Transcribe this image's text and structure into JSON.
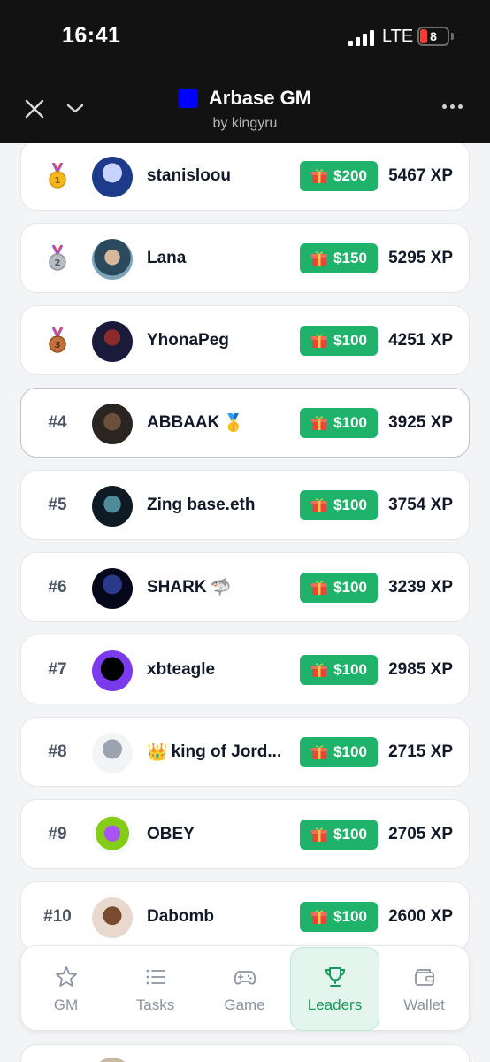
{
  "status_bar": {
    "time": "16:41",
    "network": "LTE",
    "battery": "8"
  },
  "header": {
    "title": "Arbase GM",
    "subtitle": "by kingyru"
  },
  "leaderboard": [
    {
      "rank": "",
      "medal": "gold",
      "name": "stanisloou",
      "prize": "$200",
      "xp": "5467 XP"
    },
    {
      "rank": "",
      "medal": "silver",
      "name": "Lana",
      "prize": "$150",
      "xp": "5295 XP"
    },
    {
      "rank": "",
      "medal": "bronze",
      "name": "YhonaPeg",
      "prize": "$100",
      "xp": "4251 XP"
    },
    {
      "rank": "#4",
      "name": "ABBAAK",
      "name_emoji": "🥇",
      "prize": "$100",
      "xp": "3925 XP"
    },
    {
      "rank": "#5",
      "name": "Zing base.eth",
      "prize": "$100",
      "xp": "3754 XP"
    },
    {
      "rank": "#6",
      "name": "SHARK",
      "name_emoji": "🦈",
      "prize": "$100",
      "xp": "3239 XP"
    },
    {
      "rank": "#7",
      "name": "xbteagle",
      "prize": "$100",
      "xp": "2985 XP"
    },
    {
      "rank": "#8",
      "name_prefix_emoji": "👑",
      "name": "king of Jord...",
      "prize": "$100",
      "xp": "2715 XP"
    },
    {
      "rank": "#9",
      "name": "OBEY",
      "prize": "$100",
      "xp": "2705 XP"
    },
    {
      "rank": "#10",
      "name": "Dabomb",
      "prize": "$100",
      "xp": "2600 XP"
    }
  ],
  "nav": {
    "items": [
      {
        "label": "GM",
        "icon": "star-icon"
      },
      {
        "label": "Tasks",
        "icon": "list-icon"
      },
      {
        "label": "Game",
        "icon": "gamepad-icon"
      },
      {
        "label": "Leaders",
        "icon": "trophy-icon",
        "active": true
      },
      {
        "label": "Wallet",
        "icon": "wallet-icon"
      }
    ]
  },
  "colors": {
    "accent": "#1fb26b",
    "header_bg": "#121212",
    "app_square": "#0000ff",
    "active_nav_bg": "#e3f5ec"
  }
}
